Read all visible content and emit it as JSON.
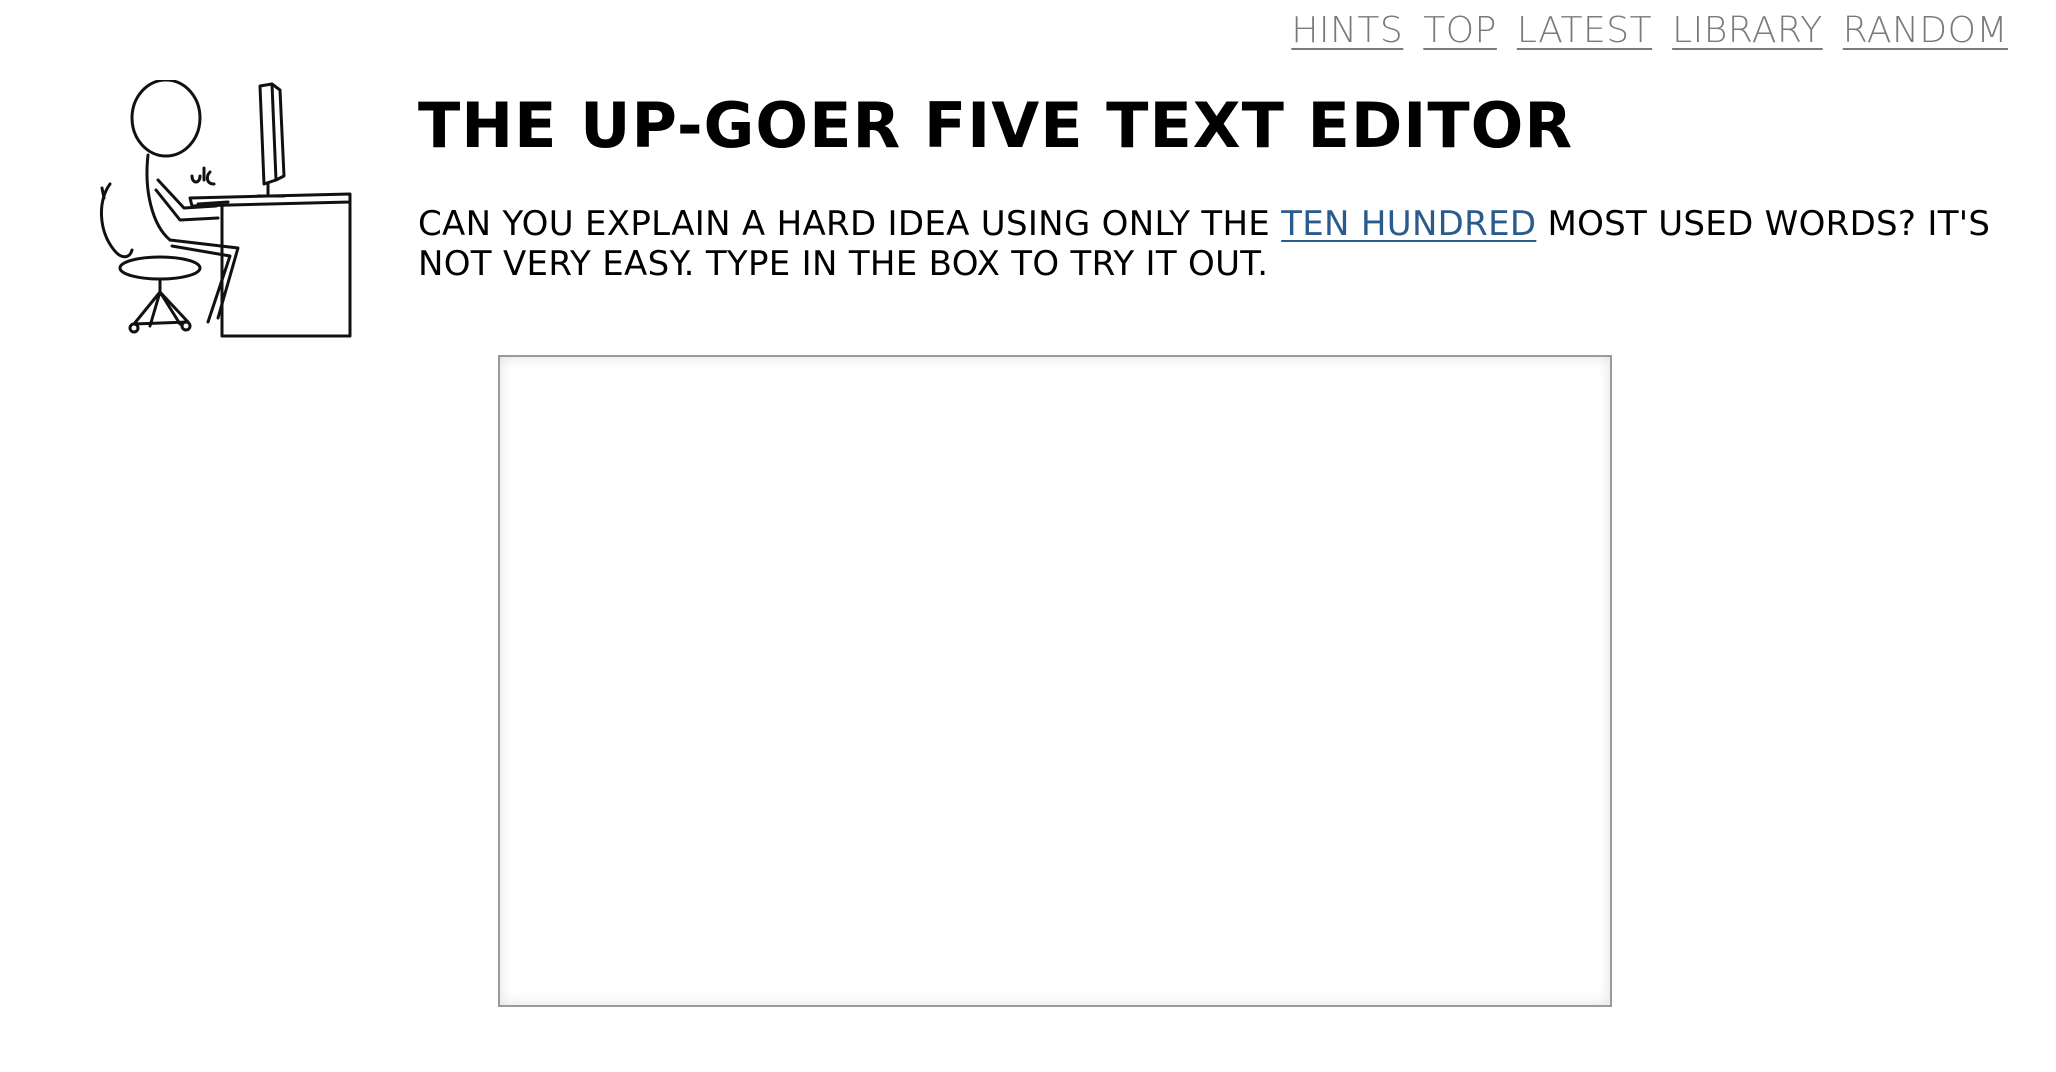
{
  "nav": {
    "items": [
      {
        "label": "HINTS"
      },
      {
        "label": "TOP"
      },
      {
        "label": "LATEST"
      },
      {
        "label": "LIBRARY"
      },
      {
        "label": "RANDOM"
      }
    ]
  },
  "header": {
    "title": "THE UP-GOER FIVE TEXT EDITOR"
  },
  "intro": {
    "before_link": "CAN YOU EXPLAIN A HARD IDEA USING ONLY THE ",
    "link_text": "TEN HUNDRED",
    "after_link": " MOST USED WORDS? IT'S NOT VERY EASY. TYPE IN THE BOX TO TRY IT OUT."
  },
  "editor": {
    "value": "",
    "placeholder": ""
  },
  "illustration": {
    "icon": "stick-figure-at-computer-icon"
  },
  "colors": {
    "nav_link": "#7a7a7a",
    "text_link": "#2a5b8e",
    "editor_border": "#9a9a9a"
  }
}
